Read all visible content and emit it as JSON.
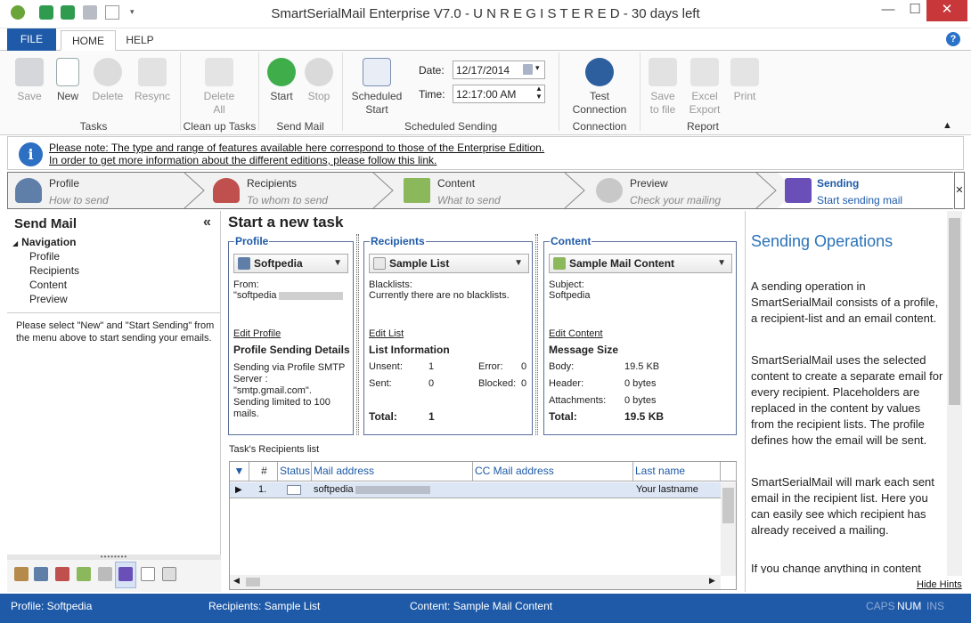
{
  "window": {
    "title": "SmartSerialMail Enterprise V7.0 - U N R E G I S T E R E D - 30 days left",
    "minimize": "—",
    "maximize": "☐",
    "close": "✕"
  },
  "tabs": {
    "file": "FILE",
    "home": "HOME",
    "help": "HELP"
  },
  "ribbon": {
    "save": "Save",
    "new": "New",
    "delete": "Delete",
    "resync": "Resync",
    "tasks_group": "Tasks",
    "delete_all_1": "Delete",
    "delete_all_2": "All",
    "cleanup_group": "Clean up Tasks",
    "start": "Start",
    "stop": "Stop",
    "sendmail_group": "Send Mail",
    "scheduled_start_1": "Scheduled",
    "scheduled_start_2": "Start",
    "date_label": "Date:",
    "date_value": "12/17/2014",
    "time_label": "Time:",
    "time_value": "12:17:00 AM",
    "scheduled_group": "Scheduled Sending",
    "test_conn_1": "Test",
    "test_conn_2": "Connection",
    "connection_group": "Connection",
    "save_file_1": "Save",
    "save_file_2": "to file",
    "excel_1": "Excel",
    "excel_2": "Export",
    "print": "Print",
    "report_group": "Report"
  },
  "info": {
    "line1": "Please note: The type and range of features available here correspond to those of the Enterprise Edition.",
    "line2": "In order to get more information about the different editions, please follow this link."
  },
  "wizard": [
    {
      "title": "Profile",
      "sub": "How to send"
    },
    {
      "title": "Recipients",
      "sub": "To whom to send"
    },
    {
      "title": "Content",
      "sub": "What to send"
    },
    {
      "title": "Preview",
      "sub": "Check your mailing"
    },
    {
      "title": "Sending",
      "sub": "Start sending mail"
    }
  ],
  "left": {
    "title": "Send Mail",
    "collapse": "«",
    "nav_root": "Navigation",
    "nav": [
      "Profile",
      "Recipients",
      "Content",
      "Preview"
    ],
    "note": "Please select \"New\" and \"Start Sending\" from the menu above to start sending your emails."
  },
  "center": {
    "title": "Start a new task",
    "profile": {
      "label": "Profile",
      "combo": "Softpedia",
      "from_label": "From:",
      "from_value": "\"softpedia",
      "edit": "Edit Profile",
      "details_title": "Profile Sending Details",
      "details": [
        "Sending via Profile SMTP",
        "Server :",
        "\"smtp.gmail.com\".",
        "Sending limited to 100",
        "mails."
      ]
    },
    "recipients": {
      "label": "Recipients",
      "combo": "Sample List",
      "blacklists_label": "Blacklists:",
      "blacklists_value": "Currently there are no blacklists.",
      "edit": "Edit List",
      "info_title": "List Information",
      "unsent_label": "Unsent:",
      "unsent": "1",
      "error_label": "Error:",
      "error": "0",
      "sent_label": "Sent:",
      "sent": "0",
      "blocked_label": "Blocked:",
      "blocked": "0",
      "total_label": "Total:",
      "total": "1"
    },
    "content": {
      "label": "Content",
      "combo": "Sample Mail Content",
      "subject_label": "Subject:",
      "subject_value": "Softpedia",
      "edit": "Edit Content",
      "size_title": "Message Size",
      "body_label": "Body:",
      "body": "19.5 KB",
      "header_label": "Header:",
      "header": "0 bytes",
      "attach_label": "Attachments:",
      "attach": "0 bytes",
      "total_label": "Total:",
      "total": "19.5 KB"
    },
    "grid": {
      "caption": "Task's Recipients list",
      "columns": [
        "#",
        "Status",
        "Mail address",
        "CC Mail address",
        "Last name"
      ],
      "row": {
        "num": "1.",
        "mail": "softpedia",
        "lastname": "Your lastname"
      }
    }
  },
  "hints": {
    "title": "Sending Operations",
    "p1": "A sending operation in SmartSerialMail consists of a profile, a recipient-list and an email content.",
    "p2": "SmartSerialMail uses the selected content to create a separate email for every recipient. Placeholders are replaced in the content by values from the recipient lists. The profile defines how the email will be sent.",
    "p3": "SmartSerialMail will mark each sent email in the recipient list. Here you can easily see which recipient has already received a mailing.",
    "p4": "If you change anything in content",
    "hide": "Hide Hints"
  },
  "status": {
    "profile": "Profile: Softpedia",
    "recipients": "Recipients: Sample List",
    "content": "Content: Sample Mail Content",
    "caps": "CAPS",
    "num": "NUM",
    "ins": "INS"
  },
  "colors": {
    "accent": "#1e5aa8",
    "link_blue": "#2a72b8"
  }
}
